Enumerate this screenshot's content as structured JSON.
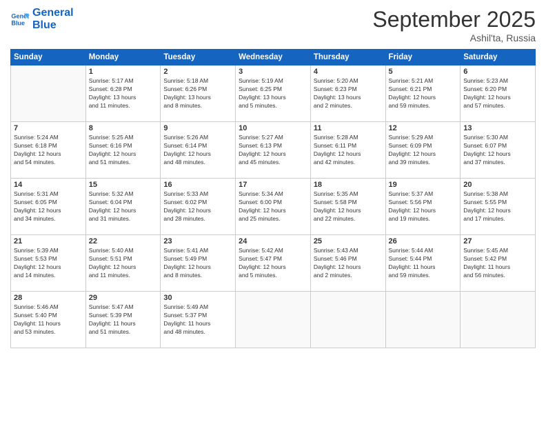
{
  "logo": {
    "line1": "General",
    "line2": "Blue"
  },
  "title": "September 2025",
  "location": "Ashil'ta, Russia",
  "days_header": [
    "Sunday",
    "Monday",
    "Tuesday",
    "Wednesday",
    "Thursday",
    "Friday",
    "Saturday"
  ],
  "weeks": [
    [
      {
        "day": "",
        "info": ""
      },
      {
        "day": "1",
        "info": "Sunrise: 5:17 AM\nSunset: 6:28 PM\nDaylight: 13 hours\nand 11 minutes."
      },
      {
        "day": "2",
        "info": "Sunrise: 5:18 AM\nSunset: 6:26 PM\nDaylight: 13 hours\nand 8 minutes."
      },
      {
        "day": "3",
        "info": "Sunrise: 5:19 AM\nSunset: 6:25 PM\nDaylight: 13 hours\nand 5 minutes."
      },
      {
        "day": "4",
        "info": "Sunrise: 5:20 AM\nSunset: 6:23 PM\nDaylight: 13 hours\nand 2 minutes."
      },
      {
        "day": "5",
        "info": "Sunrise: 5:21 AM\nSunset: 6:21 PM\nDaylight: 12 hours\nand 59 minutes."
      },
      {
        "day": "6",
        "info": "Sunrise: 5:23 AM\nSunset: 6:20 PM\nDaylight: 12 hours\nand 57 minutes."
      }
    ],
    [
      {
        "day": "7",
        "info": "Sunrise: 5:24 AM\nSunset: 6:18 PM\nDaylight: 12 hours\nand 54 minutes."
      },
      {
        "day": "8",
        "info": "Sunrise: 5:25 AM\nSunset: 6:16 PM\nDaylight: 12 hours\nand 51 minutes."
      },
      {
        "day": "9",
        "info": "Sunrise: 5:26 AM\nSunset: 6:14 PM\nDaylight: 12 hours\nand 48 minutes."
      },
      {
        "day": "10",
        "info": "Sunrise: 5:27 AM\nSunset: 6:13 PM\nDaylight: 12 hours\nand 45 minutes."
      },
      {
        "day": "11",
        "info": "Sunrise: 5:28 AM\nSunset: 6:11 PM\nDaylight: 12 hours\nand 42 minutes."
      },
      {
        "day": "12",
        "info": "Sunrise: 5:29 AM\nSunset: 6:09 PM\nDaylight: 12 hours\nand 39 minutes."
      },
      {
        "day": "13",
        "info": "Sunrise: 5:30 AM\nSunset: 6:07 PM\nDaylight: 12 hours\nand 37 minutes."
      }
    ],
    [
      {
        "day": "14",
        "info": "Sunrise: 5:31 AM\nSunset: 6:05 PM\nDaylight: 12 hours\nand 34 minutes."
      },
      {
        "day": "15",
        "info": "Sunrise: 5:32 AM\nSunset: 6:04 PM\nDaylight: 12 hours\nand 31 minutes."
      },
      {
        "day": "16",
        "info": "Sunrise: 5:33 AM\nSunset: 6:02 PM\nDaylight: 12 hours\nand 28 minutes."
      },
      {
        "day": "17",
        "info": "Sunrise: 5:34 AM\nSunset: 6:00 PM\nDaylight: 12 hours\nand 25 minutes."
      },
      {
        "day": "18",
        "info": "Sunrise: 5:35 AM\nSunset: 5:58 PM\nDaylight: 12 hours\nand 22 minutes."
      },
      {
        "day": "19",
        "info": "Sunrise: 5:37 AM\nSunset: 5:56 PM\nDaylight: 12 hours\nand 19 minutes."
      },
      {
        "day": "20",
        "info": "Sunrise: 5:38 AM\nSunset: 5:55 PM\nDaylight: 12 hours\nand 17 minutes."
      }
    ],
    [
      {
        "day": "21",
        "info": "Sunrise: 5:39 AM\nSunset: 5:53 PM\nDaylight: 12 hours\nand 14 minutes."
      },
      {
        "day": "22",
        "info": "Sunrise: 5:40 AM\nSunset: 5:51 PM\nDaylight: 12 hours\nand 11 minutes."
      },
      {
        "day": "23",
        "info": "Sunrise: 5:41 AM\nSunset: 5:49 PM\nDaylight: 12 hours\nand 8 minutes."
      },
      {
        "day": "24",
        "info": "Sunrise: 5:42 AM\nSunset: 5:47 PM\nDaylight: 12 hours\nand 5 minutes."
      },
      {
        "day": "25",
        "info": "Sunrise: 5:43 AM\nSunset: 5:46 PM\nDaylight: 12 hours\nand 2 minutes."
      },
      {
        "day": "26",
        "info": "Sunrise: 5:44 AM\nSunset: 5:44 PM\nDaylight: 11 hours\nand 59 minutes."
      },
      {
        "day": "27",
        "info": "Sunrise: 5:45 AM\nSunset: 5:42 PM\nDaylight: 11 hours\nand 56 minutes."
      }
    ],
    [
      {
        "day": "28",
        "info": "Sunrise: 5:46 AM\nSunset: 5:40 PM\nDaylight: 11 hours\nand 53 minutes."
      },
      {
        "day": "29",
        "info": "Sunrise: 5:47 AM\nSunset: 5:39 PM\nDaylight: 11 hours\nand 51 minutes."
      },
      {
        "day": "30",
        "info": "Sunrise: 5:49 AM\nSunset: 5:37 PM\nDaylight: 11 hours\nand 48 minutes."
      },
      {
        "day": "",
        "info": ""
      },
      {
        "day": "",
        "info": ""
      },
      {
        "day": "",
        "info": ""
      },
      {
        "day": "",
        "info": ""
      }
    ]
  ]
}
